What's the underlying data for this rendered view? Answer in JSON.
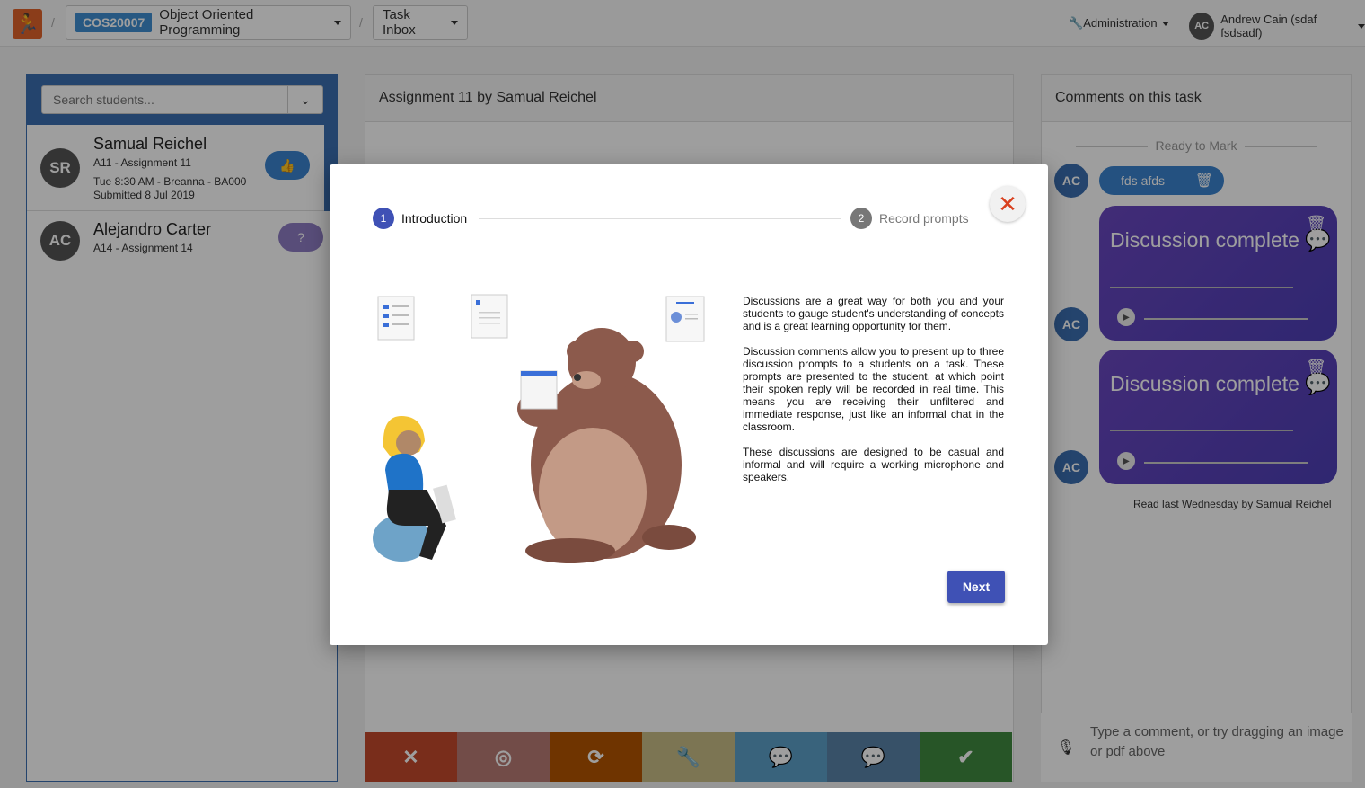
{
  "navbar": {
    "unit_code": "COS20007",
    "unit_name": "Object Oriented Programming",
    "task_inbox": "Task Inbox",
    "admin": "Administration",
    "user_initials": "AC",
    "user_name": "Andrew Cain (sdaf fsdsadf)"
  },
  "students": {
    "search_placeholder": "Search students...",
    "items": [
      {
        "initials": "SR",
        "name": "Samual Reichel",
        "task": "A11 - Assignment 11",
        "session": "Tue 8:30 AM - Breanna - BA000",
        "submitted": "Submitted 8 Jul 2019"
      },
      {
        "initials": "AC",
        "name": "Alejandro Carter",
        "task": "A14 - Assignment 14"
      }
    ]
  },
  "center": {
    "title": "Assignment 11 by Samual Reichel"
  },
  "comments": {
    "title": "Comments on this task",
    "ready": "Ready to Mark",
    "author_initials": "AC",
    "text_comment": "fds afds",
    "discussions": [
      {
        "title": "Discussion complete"
      },
      {
        "title": "Discussion complete"
      }
    ],
    "read_note": "Read last Wednesday by Samual Reichel",
    "input_placeholder": "Type a comment, or try dragging an image or pdf above"
  },
  "toolbar": {
    "colors": [
      "#c44a2c",
      "#b97b75",
      "#b35400",
      "#c8bd86",
      "#5da1c9",
      "#5a83a8",
      "#3f8a3f"
    ],
    "icons": [
      "times-icon",
      "eye-slash-icon",
      "refresh-icon",
      "wrench-icon",
      "comment-icon",
      "comments-icon",
      "check-icon"
    ]
  },
  "modal": {
    "steps": [
      {
        "num": "1",
        "label": "Introduction"
      },
      {
        "num": "2",
        "label": "Record prompts"
      }
    ],
    "paragraphs": [
      "Discussions are a great way for both you and your students to gauge student's understanding of concepts and is a great learning opportunity for them.",
      "Discussion comments allow you to present up to three discussion prompts to a students on a task. These prompts are presented to the student, at which point their spoken reply will be recorded in real time. This means you are receiving their unfiltered and immediate response, just like an informal chat in the classroom.",
      "These discussions are designed to be casual and informal and will require a working microphone and speakers."
    ],
    "next_label": "Next"
  }
}
